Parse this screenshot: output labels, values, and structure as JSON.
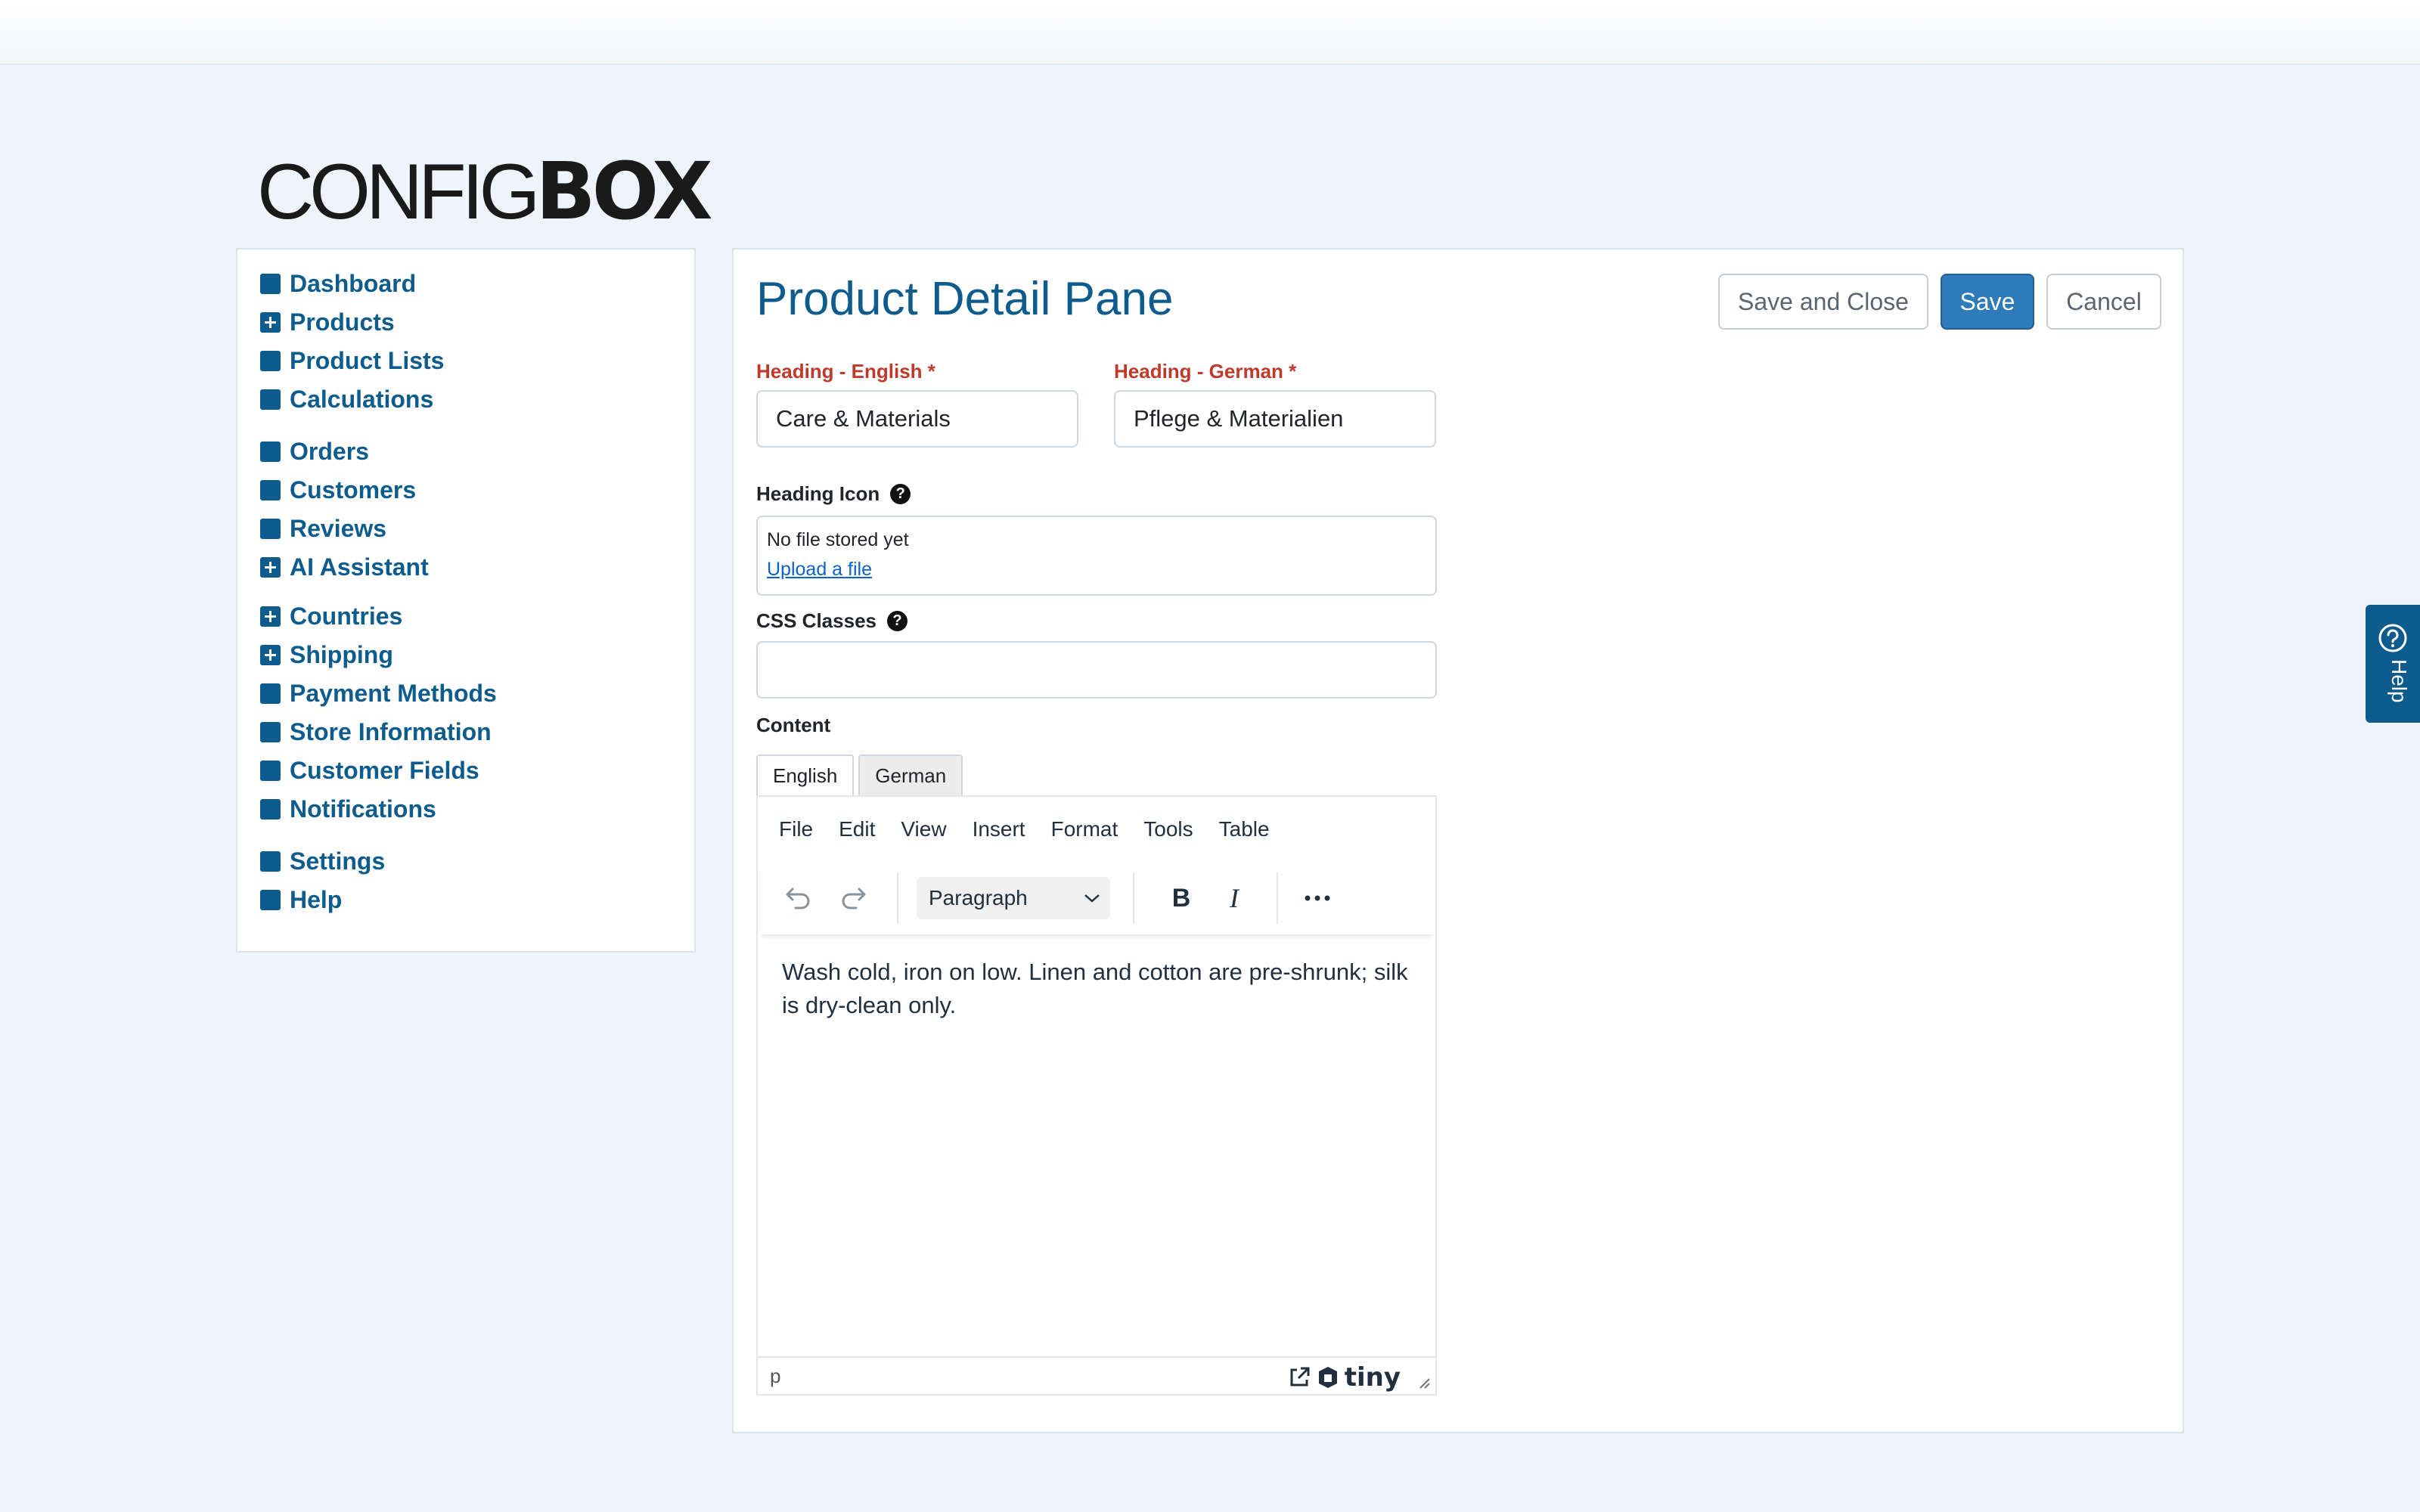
{
  "logo": {
    "part1": "CONFIG",
    "part2": "BOX"
  },
  "sidebar": {
    "groups": [
      [
        {
          "label": "Dashboard",
          "icon": "square"
        },
        {
          "label": "Products",
          "icon": "plus"
        },
        {
          "label": "Product Lists",
          "icon": "square"
        },
        {
          "label": "Calculations",
          "icon": "square"
        }
      ],
      [
        {
          "label": "Orders",
          "icon": "square"
        },
        {
          "label": "Customers",
          "icon": "square"
        },
        {
          "label": "Reviews",
          "icon": "square"
        },
        {
          "label": "AI Assistant",
          "icon": "plus"
        }
      ],
      [
        {
          "label": "Countries",
          "icon": "plus"
        },
        {
          "label": "Shipping",
          "icon": "plus"
        },
        {
          "label": "Payment Methods",
          "icon": "square"
        },
        {
          "label": "Store Information",
          "icon": "square"
        },
        {
          "label": "Customer Fields",
          "icon": "square"
        },
        {
          "label": "Notifications",
          "icon": "square"
        }
      ],
      [
        {
          "label": "Settings",
          "icon": "square"
        },
        {
          "label": "Help",
          "icon": "square"
        }
      ]
    ]
  },
  "main": {
    "title": "Product Detail Pane",
    "buttons": {
      "save_close": "Save and Close",
      "save": "Save",
      "cancel": "Cancel"
    },
    "heading_en": {
      "label": "Heading - English *",
      "value": "Care & Materials"
    },
    "heading_de": {
      "label": "Heading - German *",
      "value": "Pflege & Materialien"
    },
    "heading_icon": {
      "label": "Heading Icon",
      "status": "No file stored yet",
      "upload": "Upload a file"
    },
    "css_classes": {
      "label": "CSS Classes",
      "value": ""
    },
    "content": {
      "label": "Content",
      "tabs": [
        "English",
        "German"
      ],
      "active_tab": "English"
    }
  },
  "editor": {
    "menus": [
      "File",
      "Edit",
      "View",
      "Insert",
      "Format",
      "Tools",
      "Table"
    ],
    "block_format": "Paragraph",
    "text": "Wash cold, iron on low. Linen and cotton are pre-shrunk; silk is dry-clean only.",
    "status_path": "p",
    "brand": "tiny"
  },
  "help_tab": {
    "label": "Help"
  },
  "colors": {
    "accent": "#0e5c8e",
    "save": "#2f7ab8",
    "required": "#c0392b",
    "link": "#0b63c9"
  }
}
